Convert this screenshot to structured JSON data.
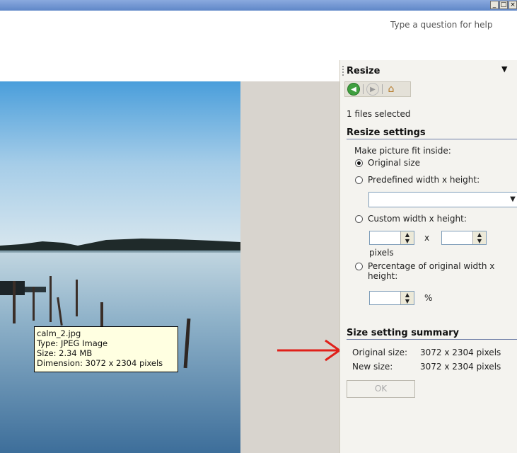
{
  "window": {
    "help_placeholder": "Type a question for help",
    "buttons": [
      "_",
      "□",
      "×"
    ]
  },
  "tooltip": {
    "filename": "calm_2.jpg",
    "type": "Type: JPEG Image",
    "size": "Size: 2.34 MB",
    "dimension": "Dimension: 3072 x 2304 pixels"
  },
  "panel": {
    "title": "Resize",
    "files_selected": "1 files selected",
    "settings_title": "Resize settings",
    "fit_label": "Make picture fit inside:",
    "options": {
      "original": "Original size",
      "predefined": "Predefined width x height:",
      "custom": "Custom width x height:",
      "percentage_line1": "Percentage of original width x",
      "percentage_line2": "height:"
    },
    "selected_option": "original",
    "x_label": "x",
    "pixels_label": "pixels",
    "percent_label": "%",
    "summary_title": "Size setting summary",
    "original_size_label": "Original size:",
    "original_size_value": "3072 x 2304 pixels",
    "new_size_label": "New size:",
    "new_size_value": "3072 x 2304 pixels",
    "ok_label": "OK"
  },
  "colors": {
    "accent": "#6f7fa8",
    "arrow": "#e0201a",
    "tooltip_bg": "#ffffe1"
  },
  "icons": [
    "back-icon",
    "forward-icon",
    "home-icon",
    "dropdown-arrow-icon",
    "red-arrow-icon"
  ]
}
